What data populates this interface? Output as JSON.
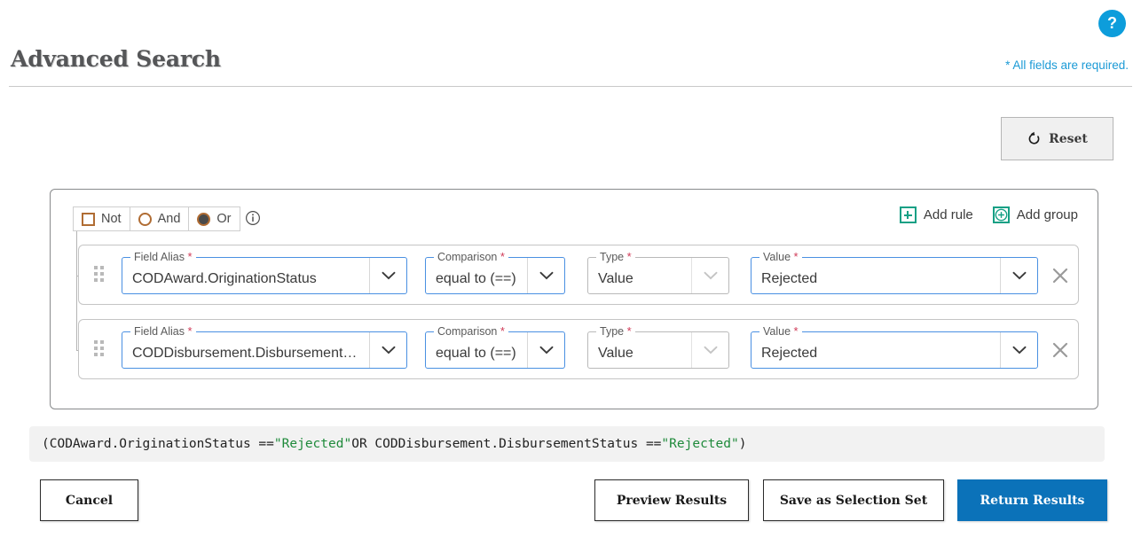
{
  "header": {
    "title": "Advanced Search",
    "help_label": "?",
    "required_note": "* All fields are required."
  },
  "toolbar": {
    "reset_label": "Reset",
    "reset_icon": "rotate-ccw-icon"
  },
  "query_builder": {
    "operators": [
      {
        "label": "Not",
        "control": "checkbox",
        "selected": false
      },
      {
        "label": "And",
        "control": "radio",
        "selected": false
      },
      {
        "label": "Or",
        "control": "radio",
        "selected": true
      }
    ],
    "info_icon": "info-circle-icon",
    "add_rule_label": "Add rule",
    "add_group_label": "Add group",
    "field_labels": {
      "field_alias": "Field Alias",
      "comparison": "Comparison",
      "type": "Type",
      "value": "Value",
      "required_star": "*"
    },
    "rules": [
      {
        "field_alias": "CODAward.OriginationStatus",
        "comparison": "equal to (==)",
        "type": "Value",
        "value": "Rejected",
        "remove_label": "×"
      },
      {
        "field_alias": "CODDisbursement.DisbursementSt…",
        "comparison": "equal to (==)",
        "type": "Value",
        "value": "Rejected",
        "remove_label": "×"
      }
    ]
  },
  "expression": {
    "part1": "(CODAward.OriginationStatus == ",
    "str1": "\"Rejected\"",
    "part2": " OR CODDisbursement.DisbursementStatus == ",
    "str2": "\"Rejected\"",
    "part3": ")"
  },
  "footer": {
    "cancel_label": "Cancel",
    "preview_label": "Preview Results",
    "save_label": "Save as Selection Set",
    "return_label": "Return Results"
  },
  "colors": {
    "accent_blue": "#0d9ddb",
    "primary_blue": "#0b72b9",
    "teal": "#16a085",
    "required_star": "#d03a57",
    "focus_border": "#4a90e2",
    "string_green": "#1f8a3b"
  }
}
